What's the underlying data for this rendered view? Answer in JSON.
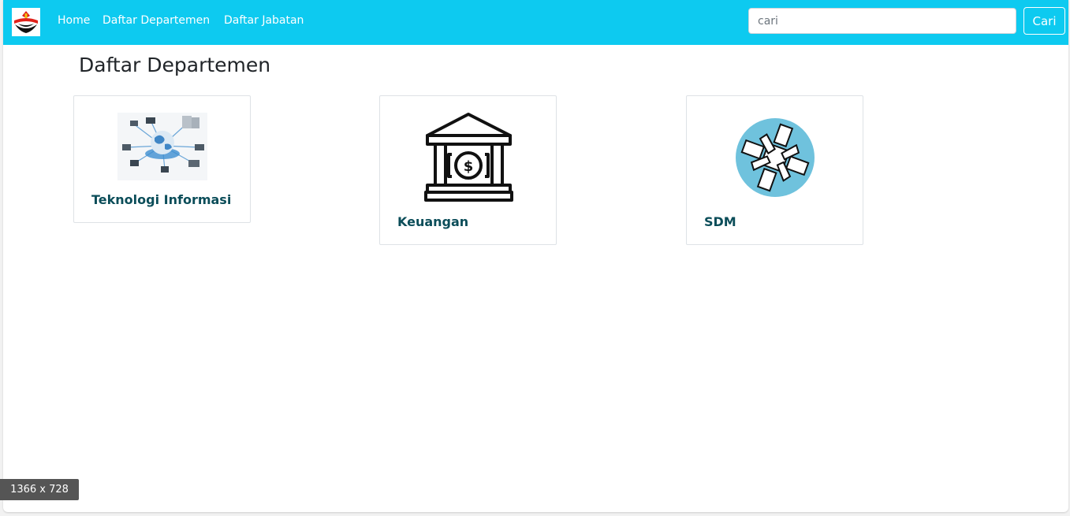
{
  "navbar": {
    "logo_icon": "upi-logo-icon",
    "links": [
      {
        "label": "Home"
      },
      {
        "label": "Daftar Departemen"
      },
      {
        "label": "Daftar Jabatan"
      }
    ],
    "search": {
      "value": "",
      "placeholder": "cari",
      "button_label": "Cari"
    },
    "background_color": "#0dcaf0"
  },
  "main": {
    "title": "Daftar Departemen",
    "cards": [
      {
        "title": "Teknologi Informasi",
        "icon": "network-globe-icon"
      },
      {
        "title": "Keuangan",
        "icon": "bank-icon"
      },
      {
        "title": "SDM",
        "icon": "joined-hands-icon"
      }
    ]
  },
  "overlay": {
    "size_label": "1366 x 728"
  }
}
